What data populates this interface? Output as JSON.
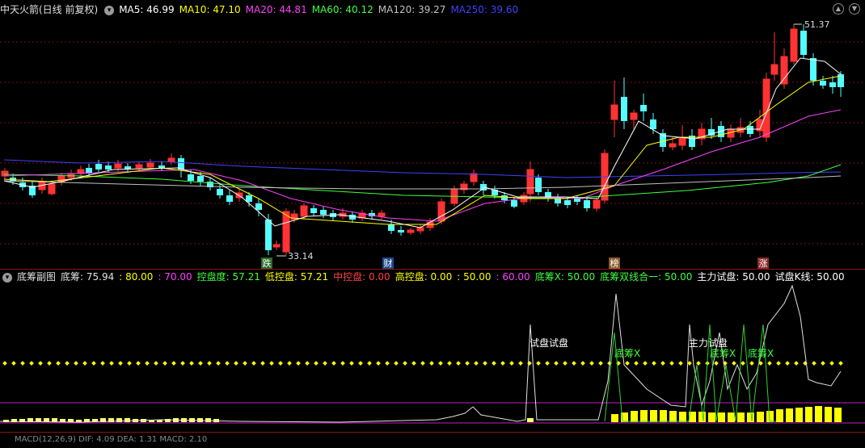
{
  "main_legend": {
    "title": "中天火箭(日线 前复权)",
    "items": [
      {
        "label": "MA5: 46.99",
        "color": "#ffffff"
      },
      {
        "label": "MA10: 47.10",
        "color": "#ffff00"
      },
      {
        "label": "MA20: 44.81",
        "color": "#ff40ff"
      },
      {
        "label": "MA60: 40.12",
        "color": "#40ff40"
      },
      {
        "label": "MA120: 39.27",
        "color": "#c0c0c0"
      },
      {
        "label": "MA250: 39.60",
        "color": "#4040ff"
      }
    ]
  },
  "price_labels": {
    "high": "51.37",
    "low": "33.14"
  },
  "event_markers": [
    {
      "text": "跌",
      "bg": "#2a6a2a",
      "color": "#ffffff"
    },
    {
      "text": "财",
      "bg": "#1a4a8a",
      "color": "#ffffff"
    },
    {
      "text": "榜",
      "bg": "#8a5a2a",
      "color": "#ffffff"
    },
    {
      "text": "涨",
      "bg": "#8a2a2a",
      "color": "#ffffff"
    }
  ],
  "sub_legend": {
    "title": "底筹副图",
    "items": [
      {
        "label": "底筹: 75.94",
        "color": "#e0e0e0"
      },
      {
        "label": ": 80.00",
        "color": "#ffff00"
      },
      {
        "label": ": 70.00",
        "color": "#ff40ff"
      },
      {
        "label": "控盘度: 57.21",
        "color": "#40ff40"
      },
      {
        "label": "低控盘: 57.21",
        "color": "#ffff00"
      },
      {
        "label": "中控盘: 0.00",
        "color": "#ff4040"
      },
      {
        "label": "高控盘: 0.00",
        "color": "#ffff00"
      },
      {
        "label": ": 50.00",
        "color": "#ffff00"
      },
      {
        "label": ": 60.00",
        "color": "#ff40ff"
      },
      {
        "label": "底筹X: 50.00",
        "color": "#40ff40"
      },
      {
        "label": "底筹双线合一: 50.00",
        "color": "#40ff40"
      },
      {
        "label": "主力试盘: 50.00",
        "color": "#ffffff"
      },
      {
        "label": "试盘K线: 50.00",
        "color": "#ffffff"
      }
    ]
  },
  "sub_annotations": {
    "try1": "试盘试盘",
    "dichou1": "底筹X",
    "try2": "主力试盘",
    "dichou2": "底筹X",
    "dichou3": "底筹X"
  },
  "bottom_legend": {
    "text": "MACD(12,26,9) DIF: 4.09 DEA: 1.31 MACD: 2.10"
  },
  "colors": {
    "up": "#ff3333",
    "down": "#54ffff",
    "separator": "#8a1010"
  }
}
